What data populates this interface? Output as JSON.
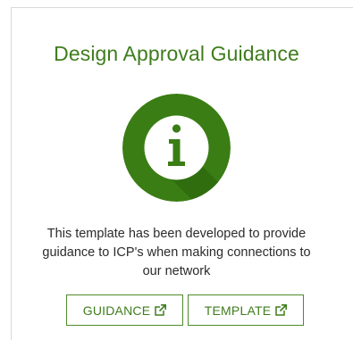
{
  "card": {
    "title": "Design Approval Guidance",
    "description": "This template has been developed to provide guidance to ICP's when making connections to our network"
  },
  "icons": {
    "info": "info-icon",
    "external_link": "external-link-icon"
  },
  "buttons": {
    "guidance_label": "GUIDANCE",
    "template_label": "TEMPLATE"
  },
  "colors": {
    "brand_green": "#3f7d1d",
    "circle_green": "#3a7d14",
    "circle_shadow": "#2f6a0e",
    "border_green": "#4f8a2b"
  }
}
